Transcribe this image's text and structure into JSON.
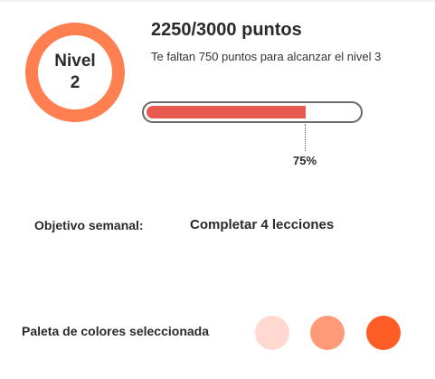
{
  "level": {
    "label": "Nivel",
    "number": "2"
  },
  "points": {
    "title": "2250/3000 puntos",
    "subtitle": "Te faltan 750 puntos para alcanzar el nivel 3"
  },
  "progress": {
    "value": 0.75,
    "percent_label": "75%"
  },
  "goal": {
    "label": "Objetivo semanal:",
    "value": "Completar 4 lecciones"
  },
  "palette": {
    "label": "Paleta de colores seleccionada",
    "colors": [
      "#ffd8cf",
      "#ff9a78",
      "#ff5c26"
    ]
  },
  "theme": {
    "accent": "#ff7f50",
    "progress_fill": "#e85a4f"
  }
}
